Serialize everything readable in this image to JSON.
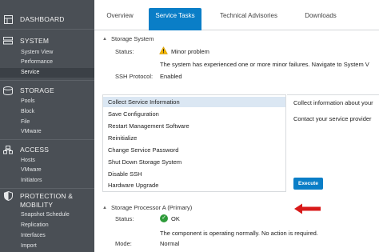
{
  "sidebar": {
    "sections": [
      {
        "icon": "dashboard-icon",
        "title": "DASHBOARD",
        "items": []
      },
      {
        "icon": "system-icon",
        "title": "SYSTEM",
        "items": [
          "System View",
          "Performance",
          "Service"
        ]
      },
      {
        "icon": "storage-icon",
        "title": "STORAGE",
        "items": [
          "Pools",
          "Block",
          "File",
          "VMware"
        ]
      },
      {
        "icon": "access-icon",
        "title": "ACCESS",
        "items": [
          "Hosts",
          "VMware",
          "Initiators"
        ]
      },
      {
        "icon": "shield-icon",
        "title": "PROTECTION &",
        "title2": "MOBILITY",
        "items": [
          "Snapshot Schedule",
          "Replication",
          "Interfaces",
          "Import"
        ]
      }
    ],
    "active_item": "Service"
  },
  "tabs": [
    "Overview",
    "Service Tasks",
    "Technical Advisories",
    "Downloads"
  ],
  "active_tab": "Service Tasks",
  "storage_system": {
    "heading": "Storage System",
    "status_label": "Status:",
    "status_value": "Minor problem",
    "message": "The system has experienced one or more minor failures. Navigate to System V",
    "ssh_label": "SSH Protocol:",
    "ssh_value": "Enabled"
  },
  "tasks": {
    "items": [
      "Collect Service Information",
      "Save Configuration",
      "Restart Management Software",
      "Reinitialize",
      "Change Service Password",
      "Shut Down Storage System",
      "Disable SSH",
      "Hardware Upgrade"
    ],
    "selected": "Collect Service Information",
    "description_1": "Collect information about your",
    "description_2": "Contact your service provider",
    "execute_label": "Execute"
  },
  "storage_processor": {
    "heading": "Storage Processor A (Primary)",
    "status_label": "Status:",
    "status_value": "OK",
    "message": "The component is operating normally. No action is required.",
    "mode_label": "Mode:",
    "mode_value": "Normal"
  },
  "colors": {
    "sidebar_bg": "#4a4f55",
    "accent": "#0a7ec7",
    "warning": "#f2b400",
    "ok": "#2e9b3a",
    "annotation_arrow": "#d81a1a"
  }
}
